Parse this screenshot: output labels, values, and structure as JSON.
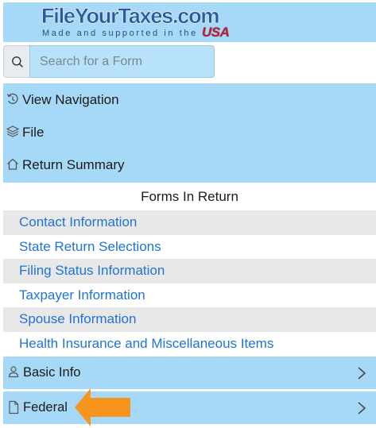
{
  "header": {
    "brand": "FileYourTaxes.com",
    "tagline": "Made and supported in the",
    "usa": "USA"
  },
  "search": {
    "placeholder": "Search for a Form",
    "value": ""
  },
  "nav": {
    "items": [
      {
        "label": "View Navigation",
        "icon": "history-icon"
      },
      {
        "label": "File",
        "icon": "layers-icon"
      },
      {
        "label": "Return Summary",
        "icon": "home-icon"
      }
    ]
  },
  "forms": {
    "title": "Forms In Return",
    "items": [
      "Contact Information",
      "State Return Selections",
      "Filing Status Information",
      "Taxpayer Information",
      "Spouse Information",
      "Health Insurance and Miscellaneous Items"
    ]
  },
  "sections": [
    {
      "label": "Basic Info",
      "icon": "person-icon"
    },
    {
      "label": "Federal",
      "icon": "document-icon"
    }
  ],
  "colors": {
    "band": "#a6d8f7",
    "link": "#1f73d6",
    "arrow": "#f7941d"
  }
}
